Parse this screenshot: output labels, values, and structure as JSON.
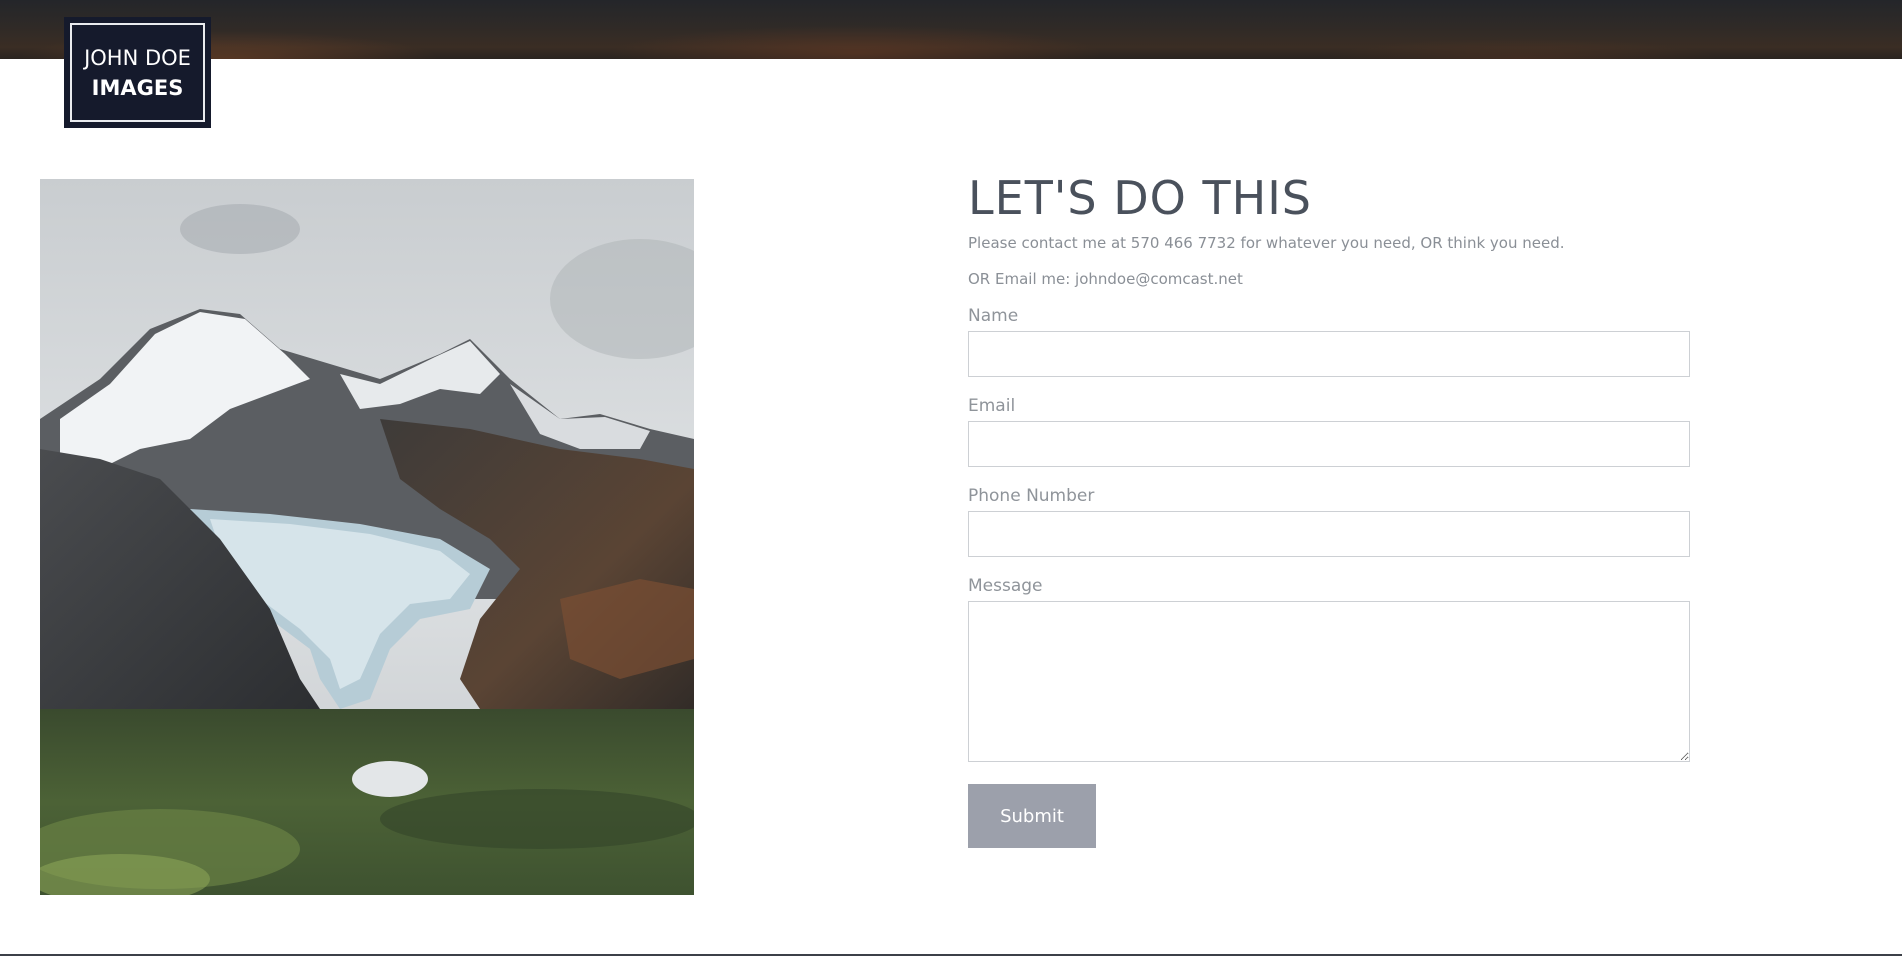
{
  "logo": {
    "line1": "JOHN DOE",
    "line2": "IMAGES"
  },
  "contact": {
    "heading": "LET'S DO THIS",
    "intro": "Please contact me at 570 466 7732 for whatever you need, OR think you need.",
    "email_line": "OR Email me: johndoe@comcast.net"
  },
  "form": {
    "name_label": "Name",
    "name_value": "",
    "email_label": "Email",
    "email_value": "",
    "phone_label": "Phone Number",
    "phone_value": "",
    "message_label": "Message",
    "message_value": "",
    "submit_label": "Submit"
  },
  "colors": {
    "logo_bg": "#151a2c",
    "heading": "#4a515c",
    "button": "#9ca0ab"
  }
}
